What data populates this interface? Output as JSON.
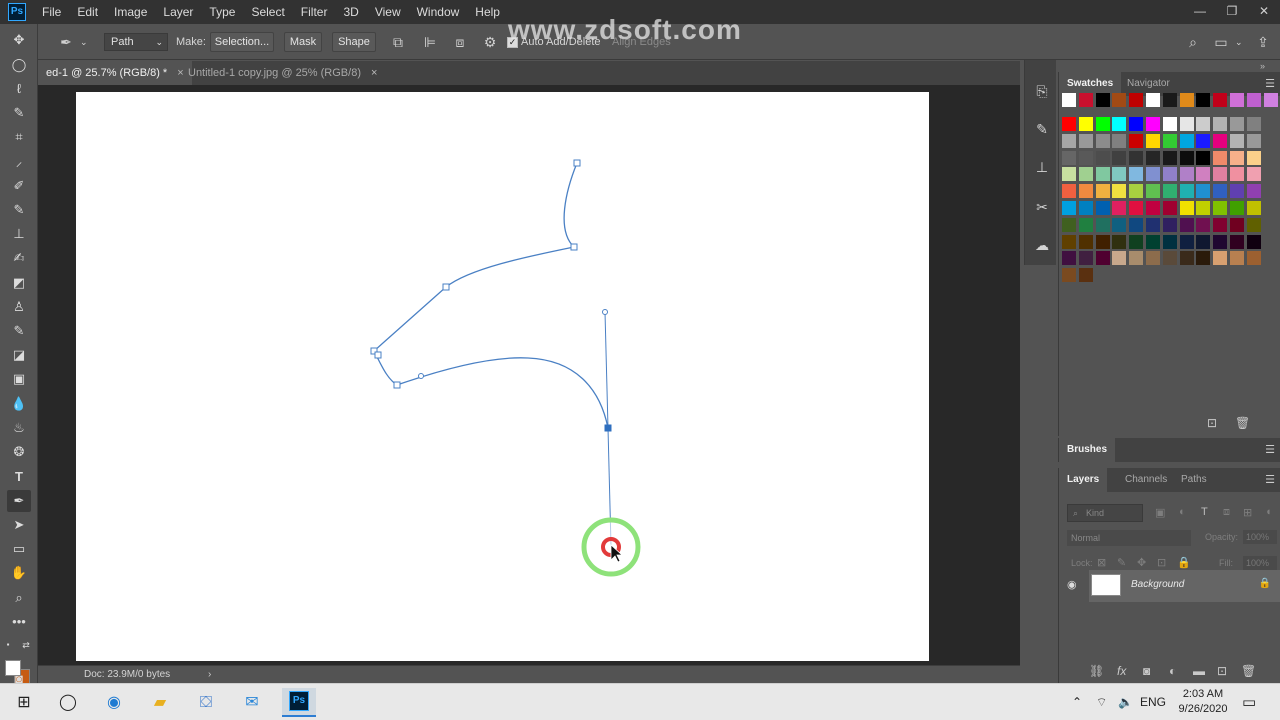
{
  "watermark": "www.zdsoft.com",
  "app": {
    "logo": "Ps"
  },
  "menu": [
    "File",
    "Edit",
    "Image",
    "Layer",
    "Type",
    "Select",
    "Filter",
    "3D",
    "View",
    "Window",
    "Help"
  ],
  "window_controls": {
    "minimize": "—",
    "restore": "❐",
    "close": "✕"
  },
  "options": {
    "mode": "Path",
    "make_label": "Make:",
    "selection_btn": "Selection...",
    "mask_btn": "Mask",
    "shape_btn": "Shape",
    "auto_add_delete": "Auto Add/Delete",
    "auto_add_delete_checked": true,
    "align_edges": "Align Edges"
  },
  "tabs": [
    {
      "title": "ed-1 @ 25.7% (RGB/8) *",
      "active": true
    },
    {
      "title": "Untitled-1 copy.jpg @ 25% (RGB/8)",
      "active": false
    }
  ],
  "tab_close": "×",
  "status": {
    "doc": "Doc: 23.9M/0 bytes",
    "arrow": "›"
  },
  "colors": {
    "foreground": "#ffffff",
    "background": "#c65b12",
    "path_stroke": "#4a80c4",
    "click_ring": "#8ee27a",
    "click_dot": "#e23a3a"
  },
  "swatches_panel": {
    "tabs": [
      "Swatches",
      "Navigator"
    ],
    "recent": [
      "#ffffff",
      "#c8102e",
      "#000000",
      "#a14a14",
      "#c00000",
      "#ffffff",
      "#1a1a1a",
      "#e08a1a",
      "#000000",
      "#c0001a",
      "#d070d8",
      "#c060d0",
      "#d080e0"
    ],
    "grid": [
      [
        "#ff0000",
        "#ffff00",
        "#00ff00",
        "#00ffff",
        "#0000ff",
        "#ff00ff",
        "#ffffff",
        "#e6e6e6",
        "#cccccc",
        "#b3b3b3",
        "#999999",
        "#808080"
      ],
      [
        "#a6a6a6",
        "#999999",
        "#8c8c8c",
        "#808080",
        "#cc0000",
        "#ffd700",
        "#33cc33",
        "#00a6e0",
        "#1a1aff",
        "#e6007e",
        "#b3b3b3",
        "#999999"
      ],
      [
        "#666666",
        "#595959",
        "#4d4d4d",
        "#404040",
        "#333333",
        "#262626",
        "#1a1a1a",
        "#0d0d0d",
        "#000000",
        "#f08a6a",
        "#f7b08a",
        "#fbd08a"
      ],
      [
        "#c8e0a0",
        "#a0d090",
        "#80c8a0",
        "#80c8c0",
        "#80b8e0",
        "#8090d0",
        "#9080c8",
        "#b080c8",
        "#d080c0",
        "#e080a0",
        "#f090a0",
        "#f0a0b0"
      ],
      [
        "#f06040",
        "#f08a40",
        "#f0b040",
        "#f0e040",
        "#a8d040",
        "#60c050",
        "#30b070",
        "#20b0b0",
        "#2090d0",
        "#3060c0",
        "#6040b0",
        "#9040b0"
      ],
      [
        "#00a0e0",
        "#0080c0",
        "#0060b0",
        "#e02060",
        "#e01040",
        "#c00040",
        "#a00030",
        "#f0e000",
        "#c0d000",
        "#80c000",
        "#40a000",
        "#c0c000"
      ],
      [
        "#406020",
        "#208040",
        "#207060",
        "#106080",
        "#104880",
        "#203070",
        "#302060",
        "#501050",
        "#701050",
        "#800030",
        "#700020",
        "#606000"
      ],
      [
        "#604000",
        "#503000",
        "#402000",
        "#303010",
        "#104020",
        "#004030",
        "#003040",
        "#102040",
        "#101830",
        "#200830",
        "#300020",
        "#100010"
      ],
      [
        "#401040",
        "#402040",
        "#500030",
        "#c8a88c",
        "#a88c6c",
        "#8c6c4c",
        "#5a4a3a",
        "#3a2a1a",
        "#2a1a0a",
        "#d8a070",
        "#b88050",
        "#9c6030"
      ],
      [
        "#7a4a20",
        "#5a3010"
      ]
    ]
  },
  "brushes_panel": {
    "tab": "Brushes"
  },
  "layers_panel": {
    "tabs": [
      "Layers",
      "Channels",
      "Paths"
    ],
    "kind_placeholder": "Kind",
    "blend_mode": "Normal",
    "opacity_label": "Opacity:",
    "opacity_value": "100%",
    "lock_label": "Lock:",
    "fill_label": "Fill:",
    "fill_value": "100%",
    "layers": [
      {
        "name": "Background",
        "visible": true,
        "locked": true
      }
    ]
  },
  "taskbar": {
    "tray_lang": "ENG",
    "time": "2:03 AM",
    "date": "9/26/2020"
  },
  "icons": {
    "tools": [
      "move-icon",
      "marquee-icon",
      "lasso-icon",
      "quick-selection-icon",
      "crop-icon",
      "eyedropper-icon",
      "healing-brush-icon",
      "brush-icon",
      "clone-stamp-icon",
      "history-brush-icon",
      "eraser-icon",
      "gradient-icon",
      "blur-icon",
      "dodge-icon",
      "pen-icon",
      "type-icon",
      "path-selection-icon",
      "rectangle-icon",
      "hand-icon",
      "zoom-icon",
      "more-tools-icon"
    ]
  }
}
